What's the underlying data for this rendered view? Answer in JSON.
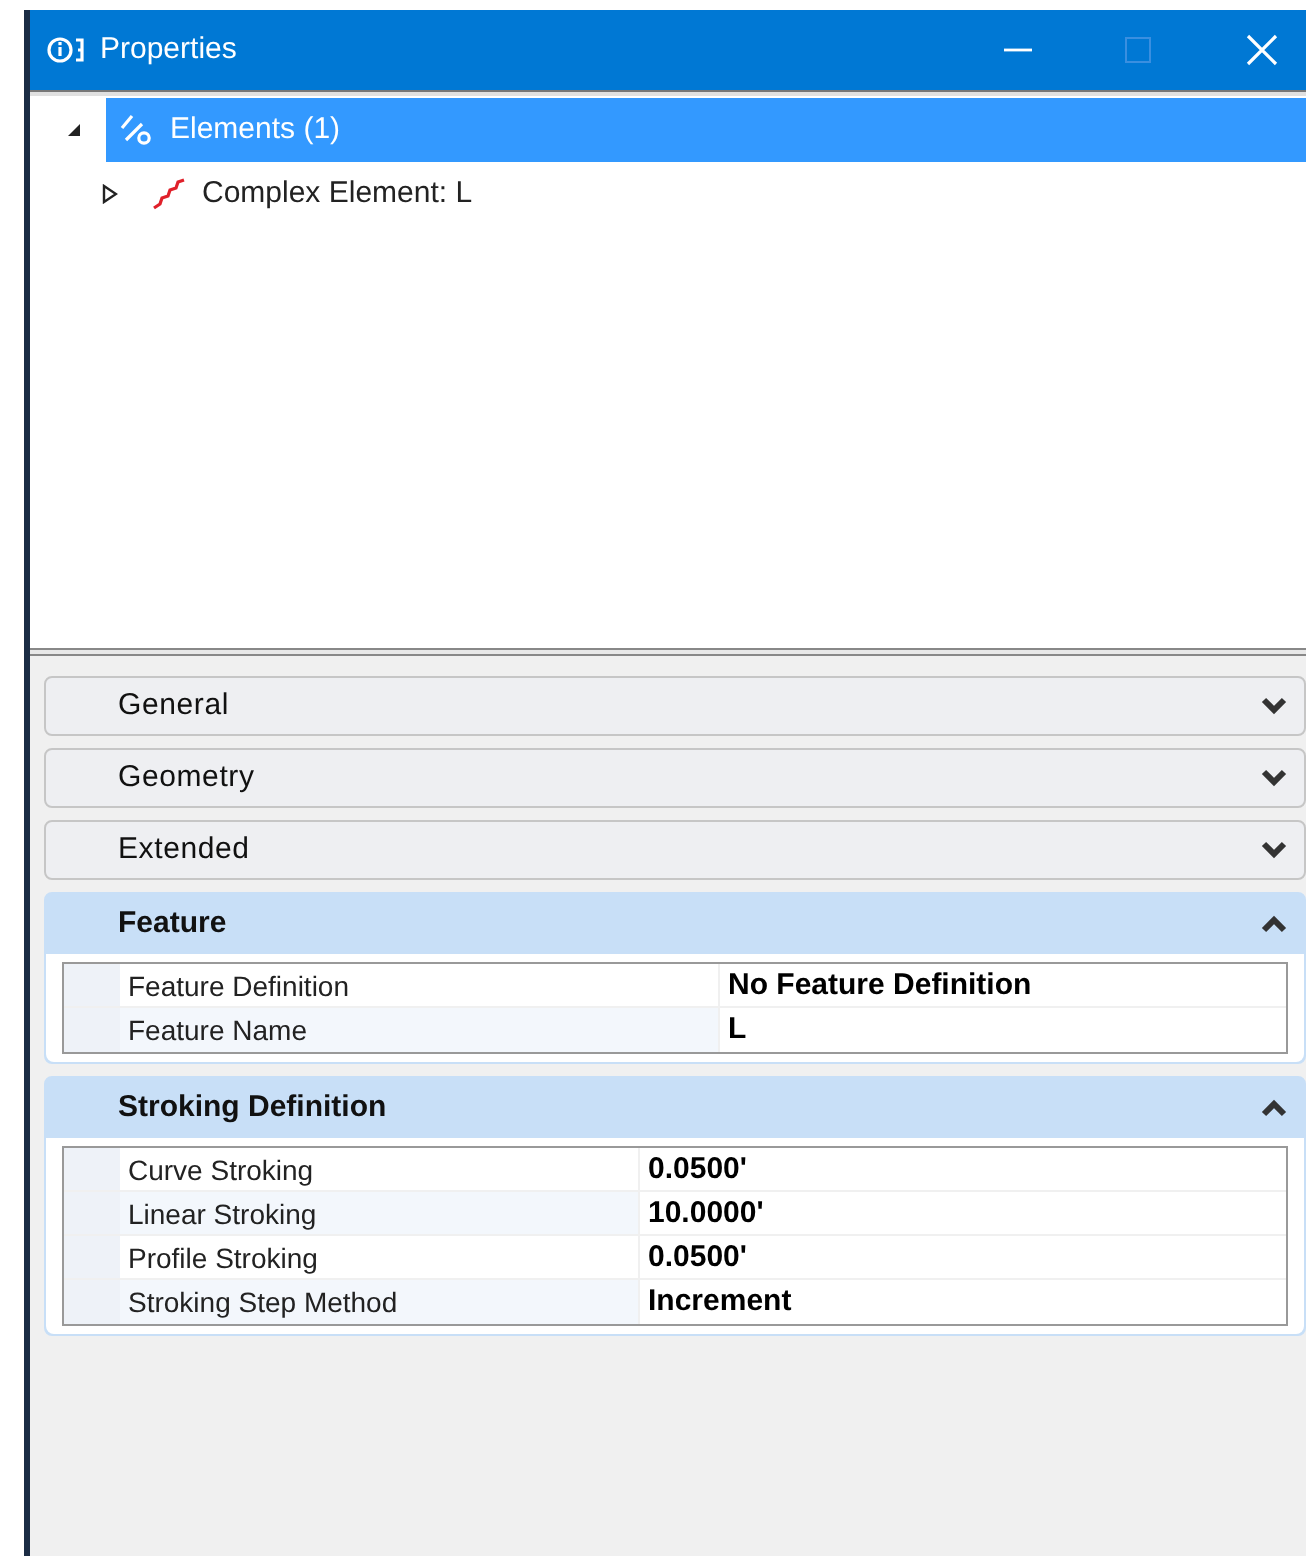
{
  "window": {
    "title": "Properties"
  },
  "tree": [
    {
      "label": "Elements (1)",
      "kind": "elements",
      "selected": true,
      "expanded": true,
      "children": [
        {
          "label": "Complex Element: L",
          "kind": "complex",
          "selected": false,
          "expanded": false
        }
      ]
    }
  ],
  "sections": [
    {
      "title": "General",
      "expanded": false
    },
    {
      "title": "Geometry",
      "expanded": false
    },
    {
      "title": "Extended",
      "expanded": false
    },
    {
      "title": "Feature",
      "expanded": true,
      "rows": [
        {
          "label": "Feature Definition",
          "value": "No Feature Definition"
        },
        {
          "label": "Feature Name",
          "value": "L"
        }
      ]
    },
    {
      "title": "Stroking Definition",
      "expanded": true,
      "rows": [
        {
          "label": "Curve Stroking",
          "value": "0.0500'"
        },
        {
          "label": "Linear Stroking",
          "value": "10.0000'"
        },
        {
          "label": "Profile Stroking",
          "value": "0.0500'"
        },
        {
          "label": "Stroking Step Method",
          "value": "Increment"
        }
      ]
    }
  ]
}
